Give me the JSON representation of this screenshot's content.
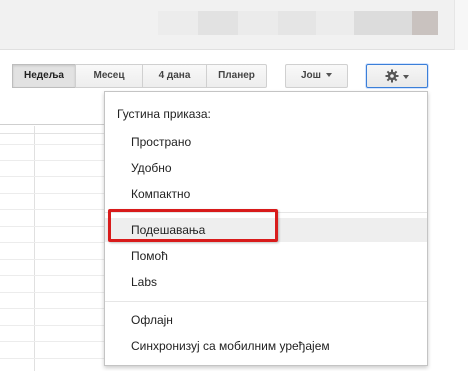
{
  "toolbar": {
    "views": [
      "Недеља",
      "Месец",
      "4 дана",
      "Планер"
    ],
    "more_label": "Још"
  },
  "settings_menu": {
    "density_heading": "Густина приказа:",
    "density_options": [
      "Пространo",
      "Удобно",
      "Компактно"
    ],
    "items": [
      "Подешавања",
      "Помоћ",
      "Labs"
    ],
    "bottom_items": [
      "Офлајн",
      "Синхронизуј са мобилним уређајем"
    ]
  },
  "colors": {
    "highlight_box": "#d81b1b",
    "settings_button_border": "#3b7fd8"
  },
  "icons": {
    "settings": "gear-icon",
    "dropdown": "chevron-down-icon"
  }
}
